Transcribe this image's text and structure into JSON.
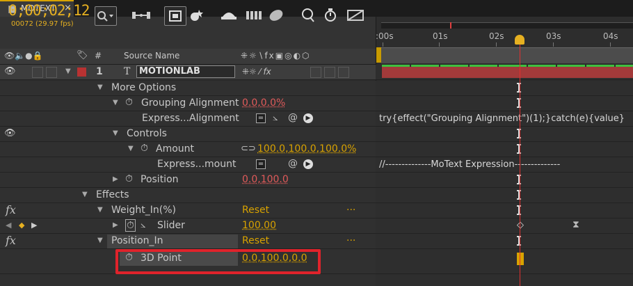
{
  "tab": {
    "title": "MOTEXT",
    "close": "×"
  },
  "toolbar": {
    "timecode": "0;00;02;12",
    "frames": "00072 (29.97 fps)",
    "search_icon": "magnifier-icon",
    "icons": [
      "search-icon",
      "compositions-flow-icon",
      "draft-3d-icon",
      "shy-layers-icon",
      "frame-blending-icon",
      "motion-blur-icon",
      "brainstorm-icon",
      "graph-editor-icon",
      "live-update-icon",
      "stopwatch-icon",
      "comp-flowchart-icon"
    ]
  },
  "ruler": {
    "labels": [
      ":00s",
      "01s",
      "02s",
      "03s",
      "04s"
    ]
  },
  "columns": {
    "source_name": "Source Name",
    "number": "#",
    "switches": "⁜☼∖fx▣◎◐⬡"
  },
  "layers": [
    {
      "num": "1",
      "name": "MOTIONLAB"
    }
  ],
  "rows": {
    "more_options": "More Options",
    "grouping_alignment": {
      "label": "Grouping Alignment",
      "value": "0.0,0.0%"
    },
    "expr_grouping": {
      "label": "Express...Alignment",
      "expr": "try{effect(\"Grouping Alignment\")(1);}catch(e){value}"
    },
    "controls": "Controls",
    "amount": {
      "label": "Amount",
      "value": "100.0,100.0,100.0%"
    },
    "expr_amount": {
      "label": "Express...mount",
      "expr": "//--------------MoText Expression--------------"
    },
    "position": {
      "label": "Position",
      "value": "0.0,100.0"
    },
    "effects": "Effects",
    "weight_in": {
      "label": "Weight_In(%)",
      "value": "Reset",
      "more": "..."
    },
    "slider": {
      "label": "Slider",
      "value": "100.00"
    },
    "position_in": {
      "label": "Position_In",
      "value": "Reset",
      "more": "..."
    },
    "point3d": {
      "label": "3D Point",
      "value": "0.0,100.0,0.0"
    }
  },
  "colors": {
    "accent": "#e6b021",
    "label_red": "#b83232",
    "highlight": "#e0232b",
    "layer_bar": "#a33a3a"
  }
}
